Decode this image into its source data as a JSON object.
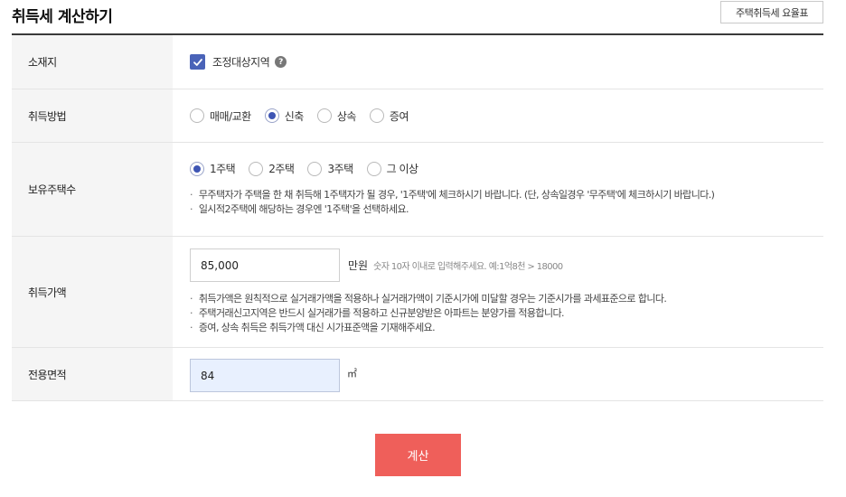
{
  "header": {
    "title": "취득세 계산하기",
    "rate_table_button": "주택취득세 요율표"
  },
  "rows": {
    "location": {
      "label": "소재지",
      "checkbox_label": "조정대상지역",
      "checked": true,
      "help_glyph": "?"
    },
    "method": {
      "label": "취득방법",
      "options": [
        {
          "label": "매매/교환",
          "checked": false
        },
        {
          "label": "신축",
          "checked": true
        },
        {
          "label": "상속",
          "checked": false
        },
        {
          "label": "증여",
          "checked": false
        }
      ]
    },
    "houses": {
      "label": "보유주택수",
      "options": [
        {
          "label": "1주택",
          "checked": true
        },
        {
          "label": "2주택",
          "checked": false
        },
        {
          "label": "3주택",
          "checked": false
        },
        {
          "label": "그 이상",
          "checked": false
        }
      ],
      "notes": [
        "무주택자가 주택을 한 채 취득해 1주택자가 될 경우, '1주택'에 체크하시기 바랍니다. (단, 상속일경우 '무주택'에 체크하시기 바랍니다.)",
        "일시적2주택에 해당하는 경우엔 '1주택'을 선택하세요."
      ]
    },
    "price": {
      "label": "취득가액",
      "value": "85,000",
      "unit": "만원",
      "hint": "숫자 10자 이내로 입력해주세요. 예:1억8천 > 18000",
      "notes": [
        "취득가액은 원칙적으로 실거래가액을 적용하나 실거래가액이 기준시가에 미달할 경우는 기준시가를 과세표준으로 합니다.",
        "주택거래신고지역은 반드시 실거래가를 적용하고 신규분양받은 아파트는 분양가를 적용합니다.",
        "증여, 상속 취득은 취득가액 대신 시가표준액을 기재해주세요."
      ]
    },
    "area": {
      "label": "전용면적",
      "value": "84",
      "unit": "㎡"
    }
  },
  "footer": {
    "calculate_button": "계산"
  },
  "colors": {
    "accent_blue": "#3e55b4",
    "checkbox_blue": "#4a63b8",
    "calc_red": "#ef5f5a"
  }
}
